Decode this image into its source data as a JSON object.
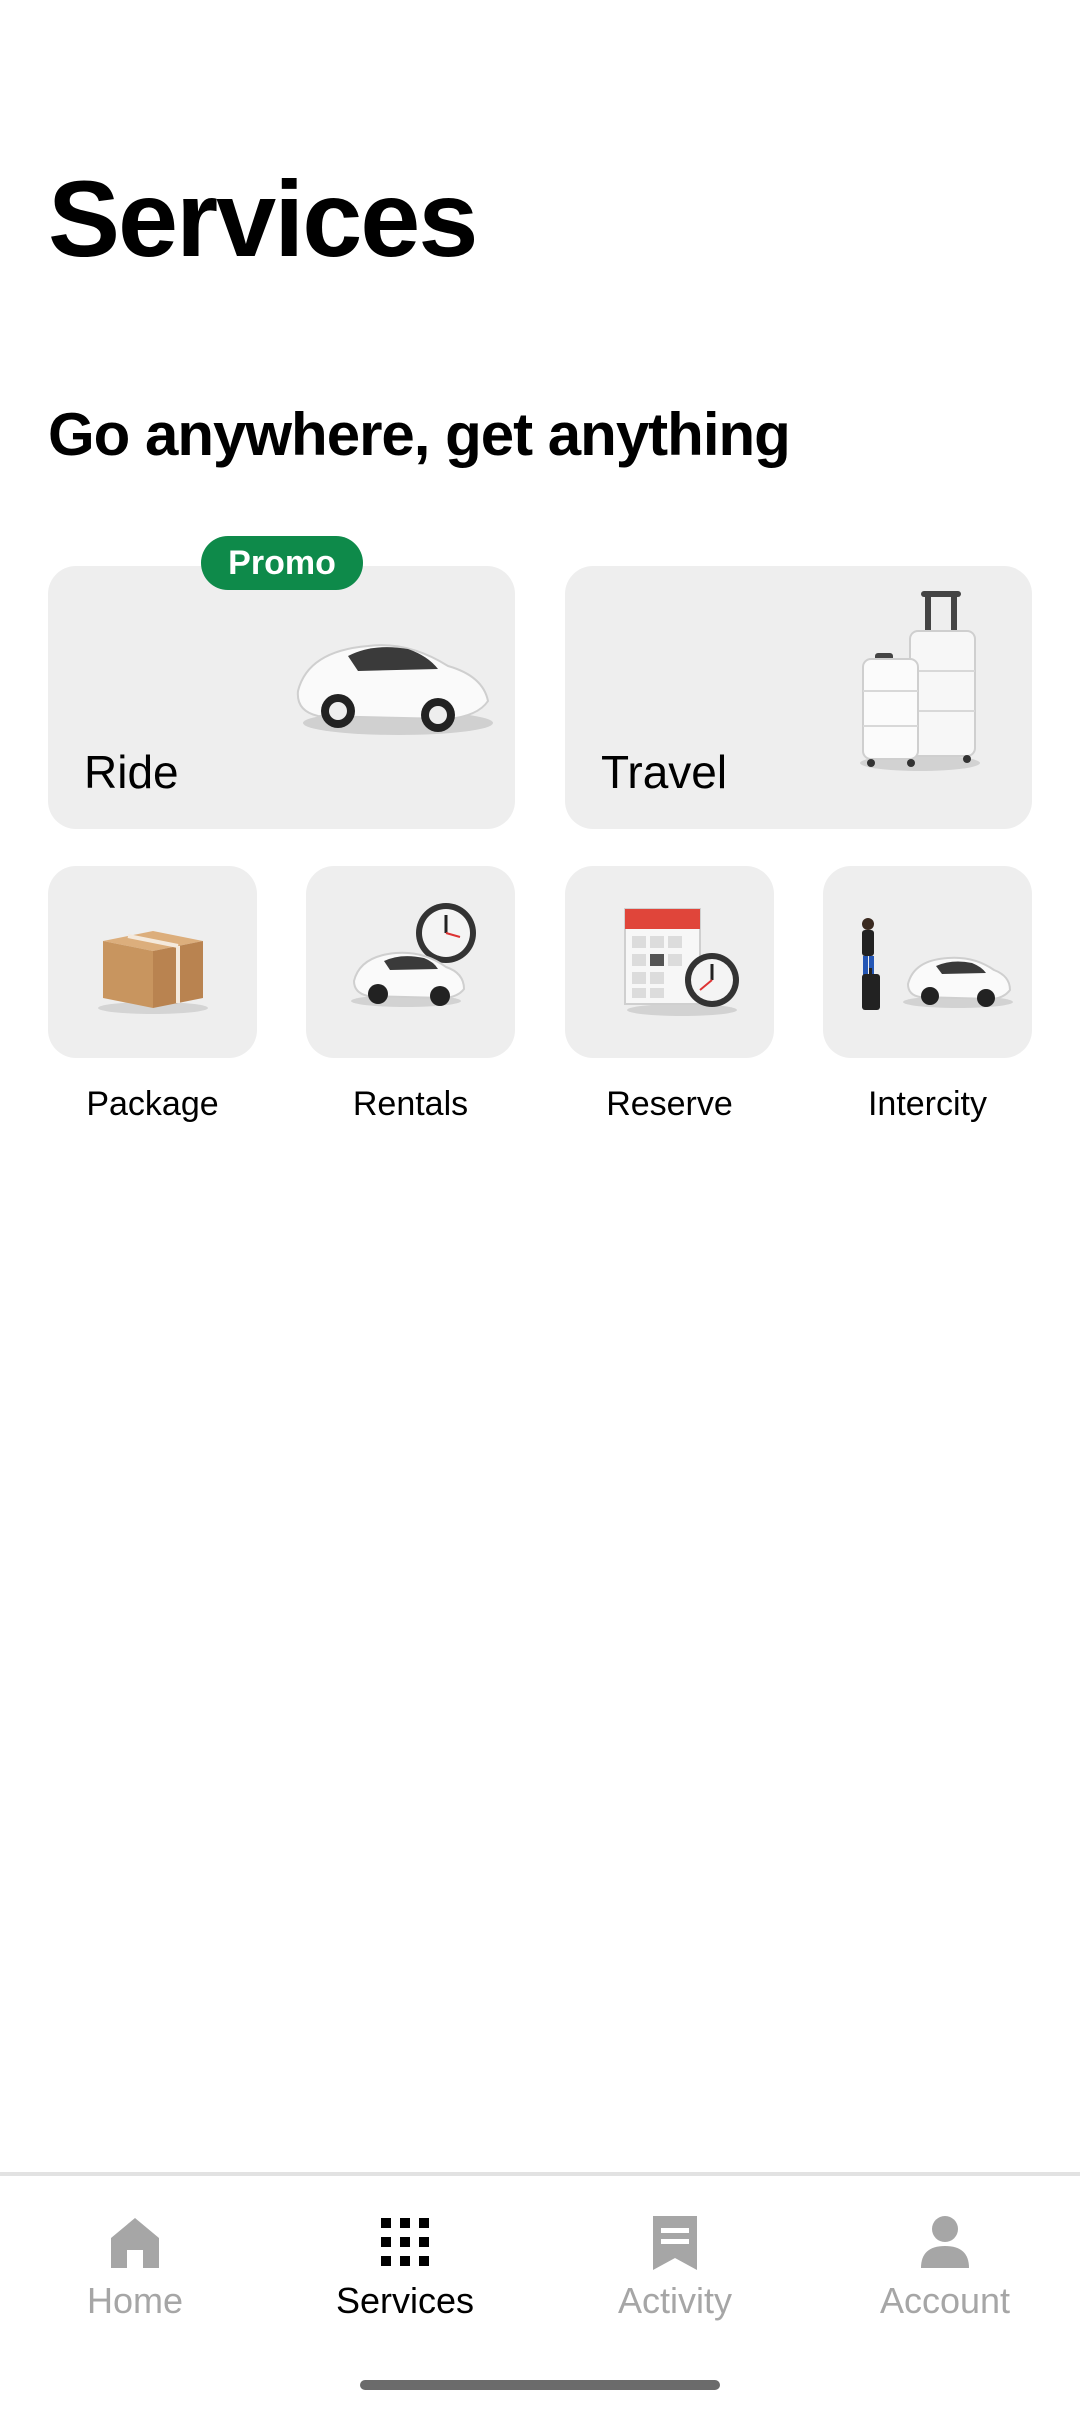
{
  "header": {
    "title": "Services"
  },
  "section": {
    "title": "Go anywhere, get anything"
  },
  "featured": [
    {
      "label": "Ride",
      "badge": "Promo",
      "icon": "car-icon"
    },
    {
      "label": "Travel",
      "icon": "luggage-icon"
    }
  ],
  "services": [
    {
      "label": "Package",
      "icon": "package-icon"
    },
    {
      "label": "Rentals",
      "icon": "car-clock-icon"
    },
    {
      "label": "Reserve",
      "icon": "calendar-clock-icon"
    },
    {
      "label": "Intercity",
      "icon": "person-car-icon"
    }
  ],
  "bottom_nav": {
    "items": [
      {
        "label": "Home",
        "icon": "home-icon",
        "active": false
      },
      {
        "label": "Services",
        "icon": "grid-icon",
        "active": true
      },
      {
        "label": "Activity",
        "icon": "receipt-icon",
        "active": false
      },
      {
        "label": "Account",
        "icon": "person-icon",
        "active": false
      }
    ]
  },
  "colors": {
    "promo_badge": "#0e8a4a",
    "tile_background": "#eeeeee",
    "nav_inactive": "#a6a6a6",
    "nav_active": "#000000"
  }
}
